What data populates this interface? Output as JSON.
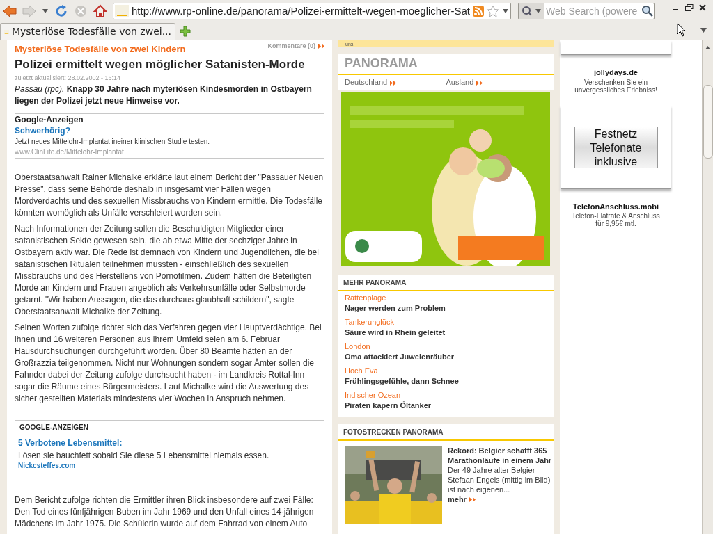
{
  "browser": {
    "url": "http://www.rp-online.de/panorama/Polizei-ermittelt-wegen-moeglicher-Sat",
    "search_placeholder": "Web Search (powere",
    "tabs": [
      {
        "title": "Mysteriöse Todesfälle von zwei...",
        "selected": true
      }
    ]
  },
  "article": {
    "kicker": "Mysteriöse Todesfälle von zwei Kindern",
    "comments": "Kommentare (0)",
    "headline": "Polizei ermittelt wegen möglicher Satanisten-Morde",
    "updated": "zuletzt aktualisiert: 28.02.2002 - 16:14",
    "lead": "*Passau (rpc).* **Knapp 30 Jahre nach myteriösen Kindesmorden in Ostbayern liegen der Polizei jetzt neue Hinweise vor.**",
    "ad_top": {
      "heading": "Google-Anzeigen",
      "title": "Schwerhörig?",
      "text": "Jetzt neues Mittelohr-Implantat ineiner klinischen Studie testen.",
      "url": "www.ClinLife.de/Mittelohr-Implantat"
    },
    "paragraphs": [
      "Oberstaatsanwalt Rainer Michalke erklärte laut einem Bericht der \"Passauer Neuen Presse\", dass seine Behörde deshalb in insgesamt vier Fällen wegen Mordverdachts und des sexuellen Missbrauchs von Kindern ermittle. Die Todesfälle könnten womöglich als Unfälle verschleiert worden sein.",
      "Nach Informationen der Zeitung sollen die Beschuldigten Mitglieder einer satanistischen Sekte gewesen sein, die ab etwa Mitte der sechziger Jahre in Ostbayern aktiv war. Die Rede ist demnach von Kindern und Jugendlichen, die bei satanistischen Ritualen teilnehmen mussten - einschließlich des sexuellen Missbrauchs und des Herstellens von Pornofilmen. Zudem hätten die Beteiligten Morde an Kindern und Frauen angeblich als Verkehrsunfälle oder Selbstmorde getarnt. \"Wir haben Aussagen, die das durchaus glaubhaft schildern\", sagte Oberstaatsanwalt Michalke der Zeitung.",
      "Seinen Worten zufolge richtet sich das Verfahren gegen vier Hauptverdächtige. Bei ihnen und 16 weiteren Personen aus ihrem Umfeld seien am 6. Februar Hausdurchsuchungen durchgeführt worden. Über 80 Beamte hätten an der Großrazzia teilgenommen. Nicht nur Wohnungen sondern sogar Ämter sollen die Fahnder dabei der Zeitung zufolge durchsucht haben - im Landkreis Rottal-Inn sogar die Räume eines Bürgermeisters. Laut Michalke wird die Auswertung des sicher gestellten Materials mindestens vier Wochen in Anspruch nehmen."
    ],
    "ad_bottom": {
      "heading": "GOOGLE-ANZEIGEN",
      "title": "5 Verbotene Lebensmittel:",
      "text": "Lösen sie bauchfett sobald Sie diese 5 Lebensmittel niemals essen.",
      "url": "Nickcsteffes.com"
    },
    "paragraphs_after": [
      "Dem Bericht zufolge richten die Ermittler ihren Blick insbesondere auf zwei Fälle: Den Tod eines fünfjährigen Buben im Jahr 1969 und den Unfall eines 14-jährigen Mädchens im Jahr 1975. Die Schülerin wurde auf dem Fahrrad von einem Auto"
    ]
  },
  "sidebar": {
    "top_note": "uns.",
    "panorama": {
      "title": "PANORAMA",
      "links": [
        "Deutschland",
        "Ausland"
      ]
    },
    "mehr": {
      "title": "MEHR PANORAMA",
      "items": [
        {
          "kicker": "Rattenplage",
          "title": "Nager werden zum Problem"
        },
        {
          "kicker": "Tankerunglück",
          "title": "Säure wird in Rhein geleitet"
        },
        {
          "kicker": "London",
          "title": "Oma attackiert Juwelenräuber"
        },
        {
          "kicker": "Hoch Eva",
          "title": "Frühlingsgefühle, dann Schnee"
        },
        {
          "kicker": "Indischer Ozean",
          "title": "Piraten kapern Öltanker"
        }
      ]
    },
    "fotostrecken": {
      "title": "FOTOSTRECKEN PANORAMA",
      "headline": "Rekord: Belgier schafft 365 Marathonläufe in einem Jahr",
      "teaser": "Der 49 Jahre alter Belgier Stefaan Engels (mittig im Bild) ist nach eigenen...",
      "more": "mehr"
    }
  },
  "ads": [
    {
      "kind": "text",
      "title": "jollydays.de",
      "text": "Verschenken Sie ein unvergessliches Erlebniss!"
    },
    {
      "kind": "button",
      "label": "Festnetz Telefonate inklusive"
    },
    {
      "kind": "text",
      "title": "TelefonAnschluss.mobi",
      "text": "Telefon-Flatrate & Anschluss für 9,95€ mtl."
    }
  ]
}
